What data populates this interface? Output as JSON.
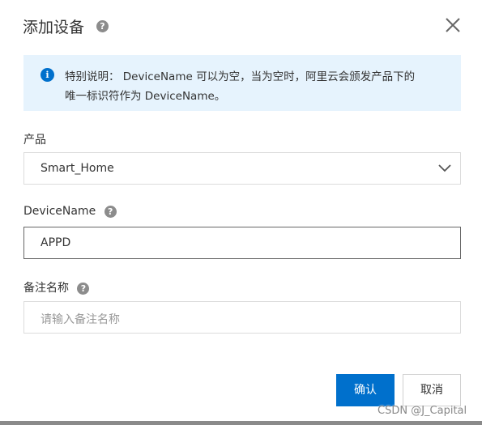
{
  "dialog": {
    "title": "添加设备",
    "title_help_icon": "question-circle-icon",
    "close_icon": "close-icon"
  },
  "notice": {
    "icon": "info-circle-icon",
    "icon_glyph": "i",
    "line1": "特别说明： DeviceName 可以为空，当为空时，阿里云会颁发产品下的",
    "line2": "唯一标识符作为 DeviceName。"
  },
  "product": {
    "label": "产品",
    "value": "Smart_Home",
    "dropdown_icon": "chevron-down-icon"
  },
  "device_name": {
    "label": "DeviceName",
    "value": "APPD",
    "help_icon": "question-circle-icon"
  },
  "remark": {
    "label": "备注名称",
    "placeholder": "请输入备注名称",
    "help_icon": "question-circle-icon"
  },
  "buttons": {
    "confirm": "确认",
    "cancel": "取消"
  },
  "watermark": "CSDN @J_Capital",
  "colors": {
    "primary": "#0070cc",
    "notice_bg": "#e6f3fd",
    "text": "#333333",
    "placeholder": "#999999"
  }
}
